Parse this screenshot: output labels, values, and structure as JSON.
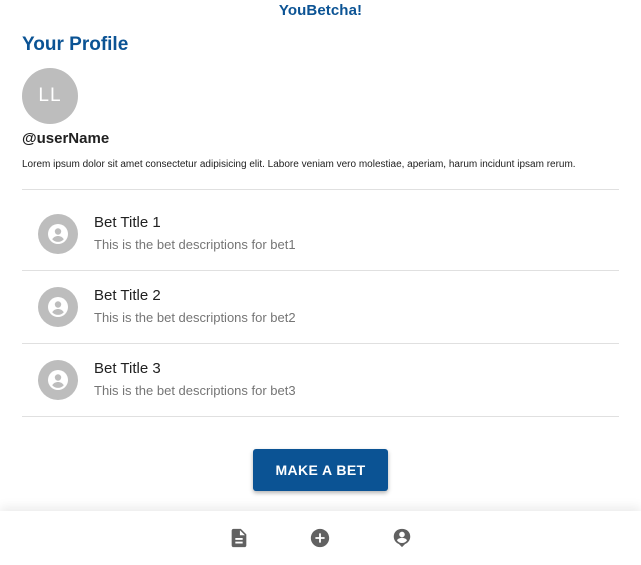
{
  "app": {
    "title": "YouBetcha!",
    "accent_color": "#0b5394"
  },
  "profile": {
    "page_title": "Your Profile",
    "avatar_initials": "LL",
    "username": "@userName",
    "bio": "Lorem ipsum dolor sit amet consectetur adipisicing elit. Labore veniam vero molestiae, aperiam, harum incidunt ipsam rerum."
  },
  "bets": [
    {
      "title": "Bet Title 1",
      "description": "This is the bet descriptions for bet1",
      "icon": "account-circle-icon"
    },
    {
      "title": "Bet Title 2",
      "description": "This is the bet descriptions for bet2",
      "icon": "account-circle-icon"
    },
    {
      "title": "Bet Title 3",
      "description": "This is the bet descriptions for bet3",
      "icon": "account-circle-icon"
    }
  ],
  "actions": {
    "make_bet_label": "MAKE A BET"
  },
  "bottom_nav": [
    {
      "icon": "document-icon"
    },
    {
      "icon": "add-circle-icon"
    },
    {
      "icon": "account-pin-icon"
    }
  ]
}
